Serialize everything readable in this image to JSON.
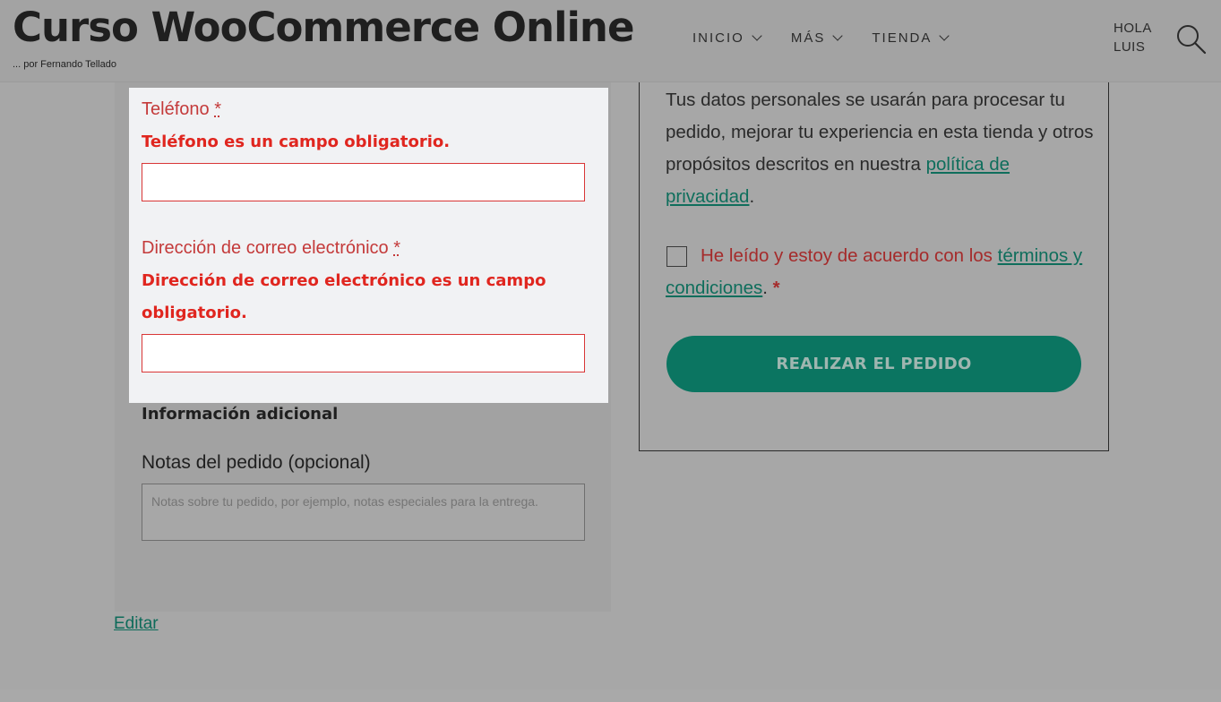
{
  "header": {
    "site_title": "Curso WooCommerce Online",
    "tagline": "... por Fernando Tellado",
    "nav": [
      {
        "label": "INICIO"
      },
      {
        "label": "MÁS"
      },
      {
        "label": "TIENDA"
      }
    ],
    "greeting_line1": "HOLA",
    "greeting_line2": "LUIS",
    "search_icon": "search-icon"
  },
  "form": {
    "phone": {
      "label": "Teléfono",
      "required_mark": "*",
      "error": "Teléfono es un campo obligatorio.",
      "value": ""
    },
    "email": {
      "label": "Dirección de correo electrónico",
      "required_mark": "*",
      "error": "Dirección de correo electrónico es un campo obligatorio.",
      "value": ""
    },
    "additional_info_title": "Información adicional",
    "notes_label": "Notas del pedido (opcional)",
    "notes_placeholder": "Notas sobre tu pedido, por ejemplo, notas especiales para la entrega."
  },
  "edit_link": "Editar",
  "order": {
    "privacy_text": "Tus datos personales se usarán para procesar tu pedido, mejorar tu experiencia en esta tienda y otros propósitos descritos en nuestra ",
    "privacy_link": "política de privacidad",
    "privacy_end": ".",
    "terms_text": "He leído y estoy de acuerdo con los ",
    "terms_link": "términos y condiciones",
    "terms_end": ". ",
    "terms_required": "*",
    "terms_checked": false,
    "place_order_label": "REALIZAR EL PEDIDO"
  },
  "colors": {
    "error": "#e0261f",
    "link": "#0f6e5c",
    "button": "#0b7561"
  }
}
